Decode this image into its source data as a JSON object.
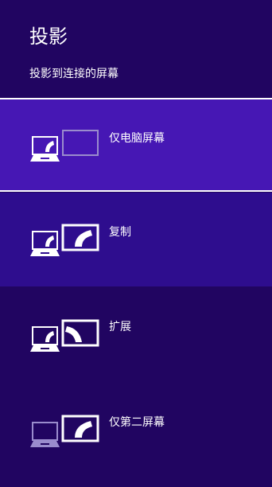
{
  "pane": {
    "title": "投影",
    "subtitle": "投影到连接的屏幕"
  },
  "options": [
    {
      "label": "仅电脑屏幕",
      "selected": true,
      "icon": "pc-screen-only-icon"
    },
    {
      "label": "复制",
      "selected": false,
      "icon": "duplicate-icon"
    },
    {
      "label": "扩展",
      "selected": false,
      "icon": "extend-icon"
    },
    {
      "label": "仅第二屏幕",
      "selected": false,
      "icon": "second-screen-only-icon"
    }
  ],
  "colors": {
    "background": "#210561",
    "selected": "#4617b4",
    "hover": "#2e0d8e",
    "accent": "#ffffff",
    "dimmed": "#9a8ccd"
  }
}
